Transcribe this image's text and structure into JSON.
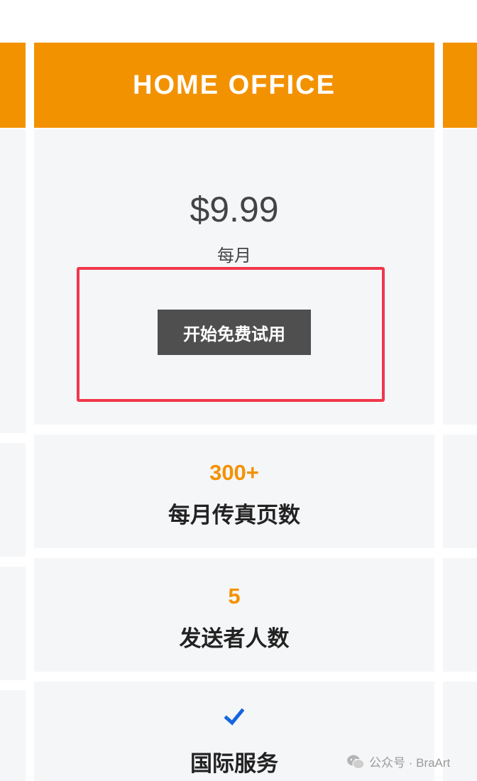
{
  "plan": {
    "title": "HOME OFFICE",
    "price": "$9.99",
    "period": "每月",
    "cta_label": "开始免费试用"
  },
  "features": [
    {
      "value": "300+",
      "label": "每月传真页数"
    },
    {
      "value": "5",
      "label": "发送者人数"
    },
    {
      "icon": "checkmark-icon",
      "label": "国际服务"
    }
  ],
  "watermark": {
    "text": "公众号 · BraArt",
    "icon": "wechat-icon"
  },
  "colors": {
    "header_orange": "#f39200",
    "cell_gray": "#f5f6f8",
    "button_dark": "#4f4f4f",
    "highlight_red": "#f0374b",
    "check_blue": "#1565e0"
  }
}
